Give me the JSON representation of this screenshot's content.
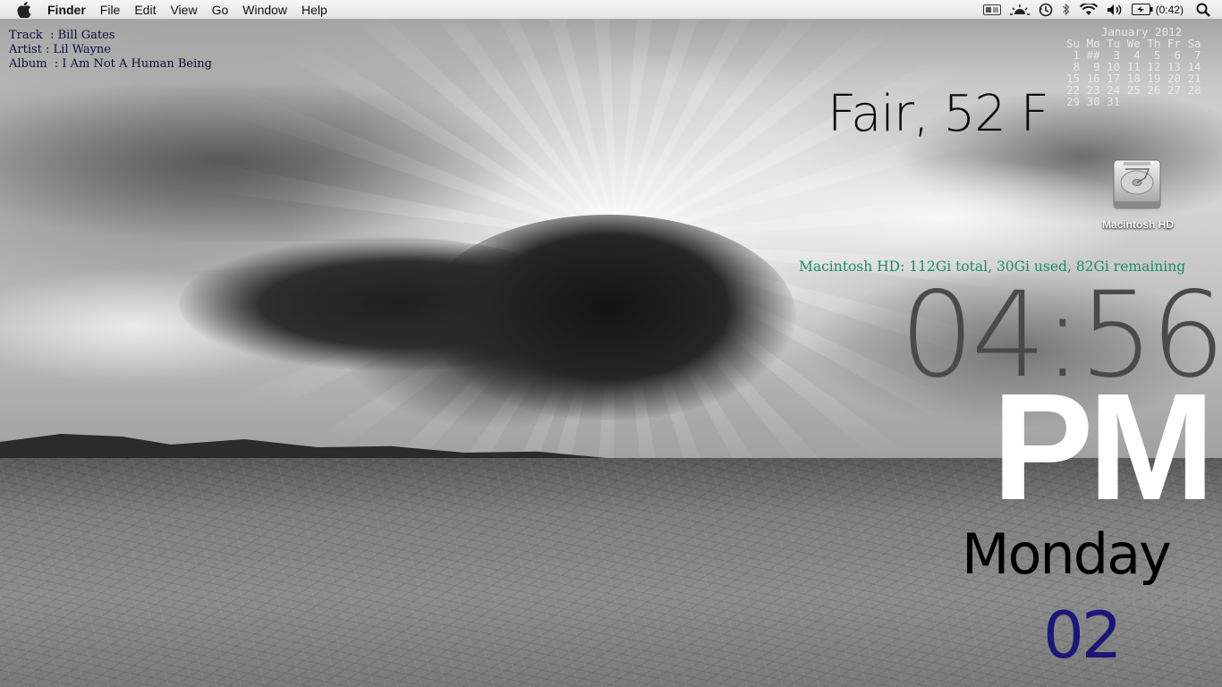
{
  "menubar": {
    "apple_icon": "apple-icon",
    "items": [
      "Finder",
      "File",
      "Edit",
      "View",
      "Go",
      "Window",
      "Help"
    ],
    "status": {
      "icons": [
        "network-activity-icon",
        "brightness-icon",
        "time-machine-icon",
        "bluetooth-icon",
        "wifi-icon",
        "volume-icon",
        "battery-icon",
        "spotlight-icon"
      ],
      "battery_text": "(0:42)"
    }
  },
  "itunes": {
    "track": "Track  : Bill Gates",
    "artist": "Artist : Lil Wayne",
    "album": "Album  : I Am Not A Human Being"
  },
  "calendar": {
    "title": "January 2012",
    "rows": [
      "Su Mo Tu We Th Fr Sa",
      " 1 ##  3  4  5  6  7",
      " 8  9 10 11 12 13 14",
      "15 16 17 18 19 20 21",
      "22 23 24 25 26 27 28",
      "29 30 31"
    ]
  },
  "weather": "Fair, 52 F",
  "desktop": {
    "hd_label": "Macintosh HD",
    "disk_info": "Macintosh HD: 112Gi total, 30Gi used, 82Gi remaining"
  },
  "clock": {
    "time": "04:56",
    "ampm": "PM",
    "day": "Monday",
    "month": "January",
    "date": "02"
  },
  "colors": {
    "disk_text": "#1c8f62",
    "date_text": "#1c1679",
    "itunes_text": "#0c0c3a"
  }
}
